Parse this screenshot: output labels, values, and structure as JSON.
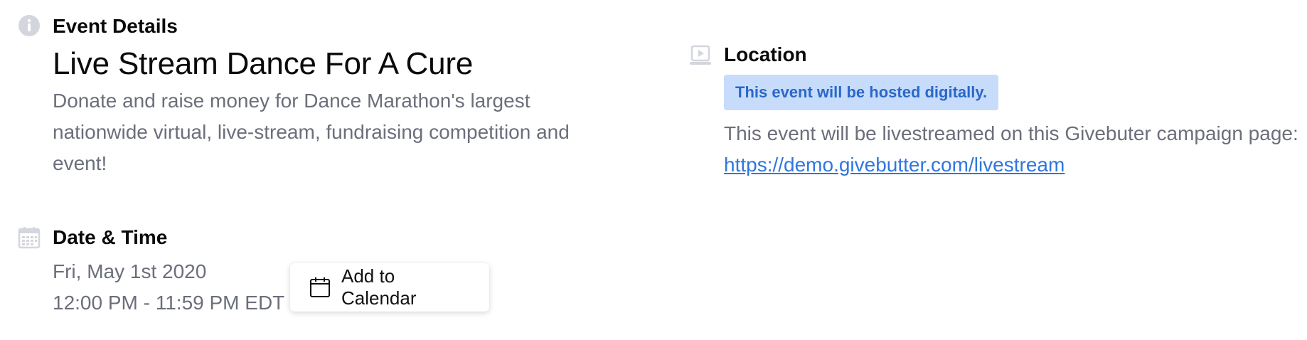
{
  "event_details": {
    "heading": "Event Details",
    "icon": "info-icon",
    "title": "Live Stream Dance For A Cure",
    "description_lines": [
      "Donate and raise money for Dance Marathon's largest",
      "nationwide virtual, live-stream, fundraising competition and",
      "event!"
    ]
  },
  "date_time": {
    "heading": "Date & Time",
    "icon": "calendar-icon",
    "date": "Fri, May 1st 2020",
    "time": "12:00 PM - 11:59 PM EDT",
    "add_to_calendar_label": "Add to Calendar"
  },
  "location": {
    "heading": "Location",
    "icon": "video-play-icon",
    "badge": "This event will be hosted digitally.",
    "description": "This event will be livestreamed on this Givebuter campaign page:",
    "link": "https://demo.givebutter.com/livestream"
  },
  "colors": {
    "icon_gray": "#d4d6de",
    "badge_bg": "#c7dcfb",
    "badge_text": "#2a67c9",
    "link": "#2f76de",
    "muted_text": "#6b6f7b"
  }
}
